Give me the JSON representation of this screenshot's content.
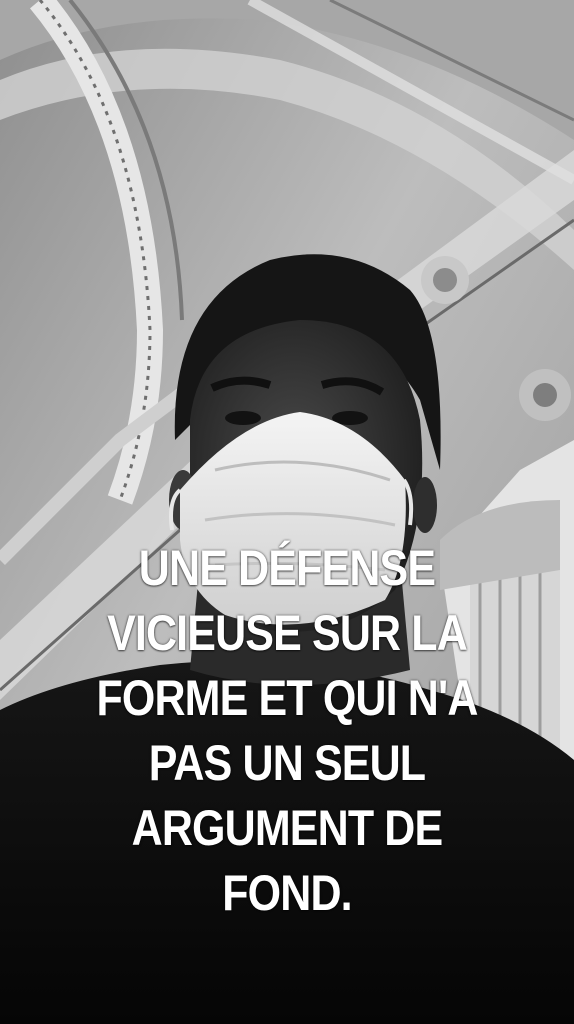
{
  "story": {
    "caption_lines": [
      "UNE DÉFENSE",
      "VICIEUSE SUR LA",
      "FORME ET QUI N'A",
      "PAS UN SEUL",
      "ARGUMENT DE",
      "FOND."
    ]
  }
}
